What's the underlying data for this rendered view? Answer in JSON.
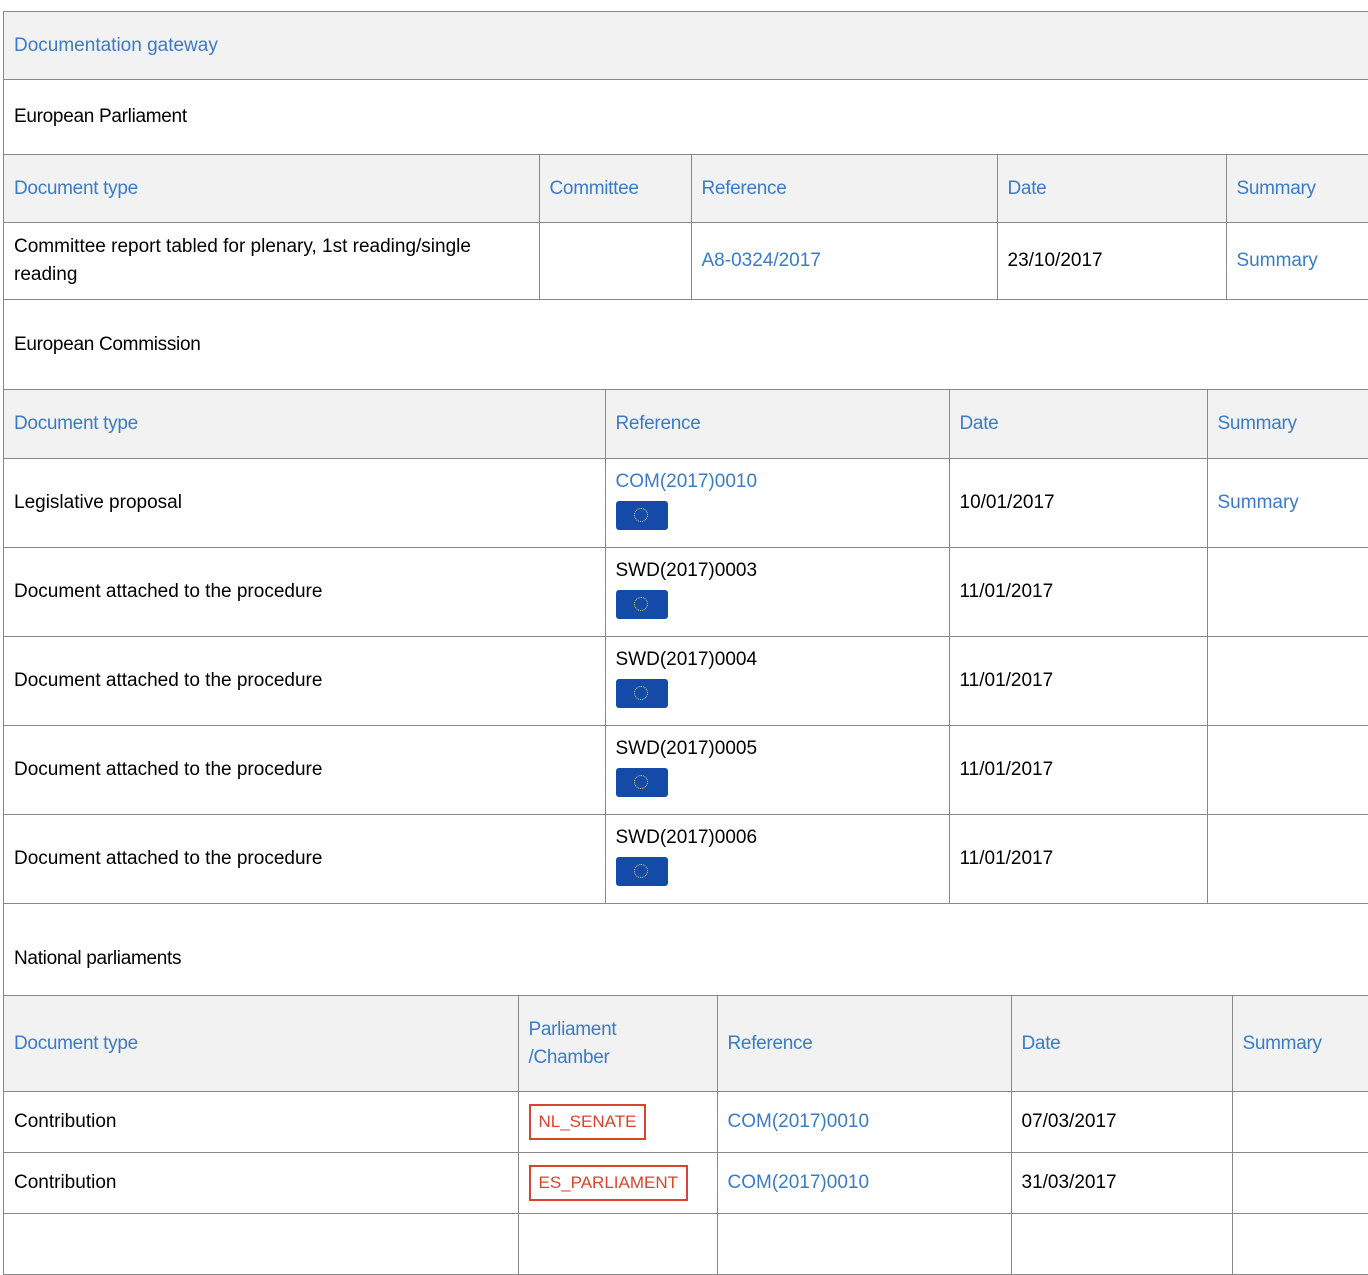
{
  "gateway": {
    "title": "Documentation gateway"
  },
  "ep": {
    "title": "European Parliament",
    "headers": {
      "doc_type": "Document type",
      "committee": "Committee",
      "reference": "Reference",
      "date": "Date",
      "summary": "Summary"
    },
    "rows": [
      {
        "doc_type": "Committee report tabled for plenary, 1st reading/single reading",
        "committee": "",
        "reference": "A8-0324/2017",
        "date": "23/10/2017",
        "summary": "Summary"
      }
    ]
  },
  "ec": {
    "title": "European Commission",
    "headers": {
      "doc_type": "Document type",
      "reference": "Reference",
      "date": "Date",
      "summary": "Summary"
    },
    "rows": [
      {
        "doc_type": "Legislative proposal",
        "reference": "COM(2017)0010",
        "date": "10/01/2017",
        "summary": "Summary"
      },
      {
        "doc_type": "Document attached to the procedure",
        "reference": "SWD(2017)0003",
        "date": "11/01/2017",
        "summary": ""
      },
      {
        "doc_type": "Document attached to the procedure",
        "reference": "SWD(2017)0004",
        "date": "11/01/2017",
        "summary": ""
      },
      {
        "doc_type": "Document attached to the procedure",
        "reference": "SWD(2017)0005",
        "date": "11/01/2017",
        "summary": ""
      },
      {
        "doc_type": "Document attached to the procedure",
        "reference": "SWD(2017)0006",
        "date": "11/01/2017",
        "summary": ""
      }
    ]
  },
  "np": {
    "title": "National parliaments",
    "headers": {
      "doc_type": "Document type",
      "chamber": "Parliament /Chamber",
      "reference": "Reference",
      "date": "Date",
      "summary": "Summary"
    },
    "rows": [
      {
        "doc_type": "Contribution",
        "chamber": "NL_SENATE",
        "reference": "COM(2017)0010",
        "date": "07/03/2017",
        "summary": ""
      },
      {
        "doc_type": "Contribution",
        "chamber": "ES_PARLIAMENT",
        "reference": "COM(2017)0010",
        "date": "31/03/2017",
        "summary": ""
      },
      {
        "doc_type": "",
        "chamber": "",
        "reference": "",
        "date": "",
        "summary": ""
      }
    ]
  },
  "colors": {
    "link": "#3a7bc8",
    "badge": "#d9452c",
    "header_bg": "#f2f2f2",
    "border": "#888888"
  },
  "icons": {
    "eu_doc": "eu-flag-icon"
  }
}
